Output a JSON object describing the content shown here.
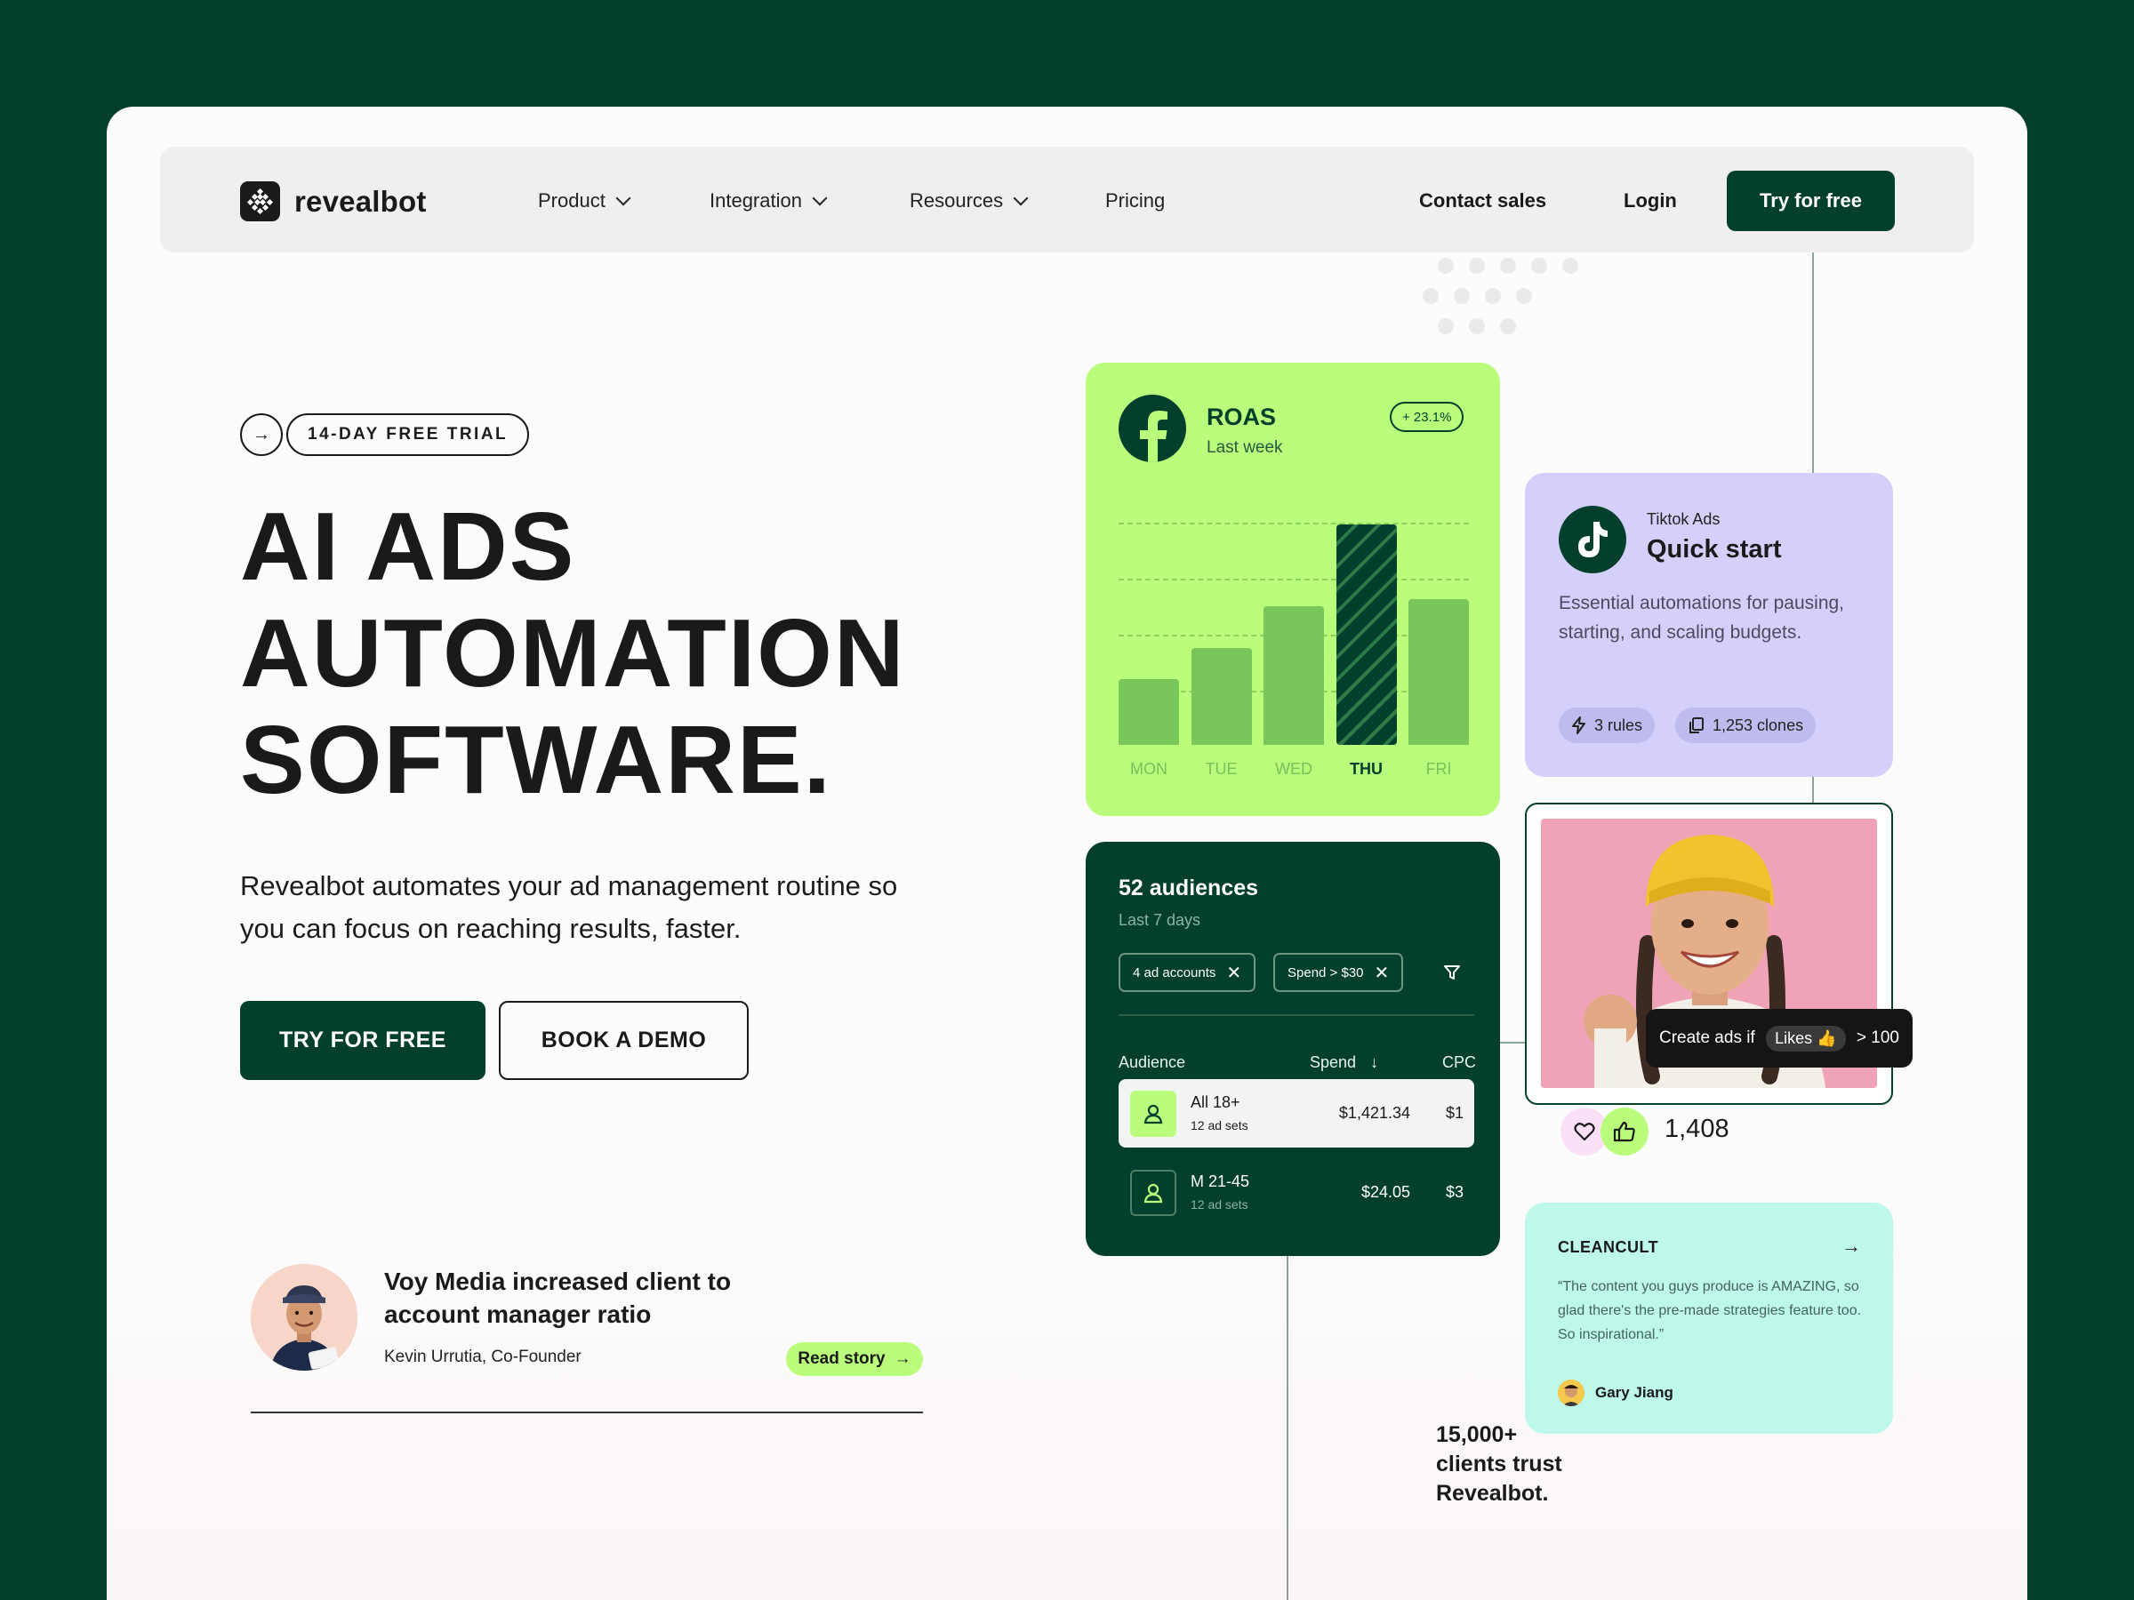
{
  "nav": {
    "brand": "revealbot",
    "items": [
      {
        "label": "Product",
        "has_dropdown": true
      },
      {
        "label": "Integration",
        "has_dropdown": true
      },
      {
        "label": "Resources",
        "has_dropdown": true
      },
      {
        "label": "Pricing",
        "has_dropdown": false
      }
    ],
    "contact": "Contact sales",
    "login": "Login",
    "cta": "Try for free"
  },
  "hero": {
    "badge": "14-DAY FREE TRIAL",
    "headline_lines": [
      "AI ADS",
      "AUTOMATION",
      "SOFTWARE."
    ],
    "subtitle": "Revealbot automates your ad management routine so you can focus on reaching results, faster.",
    "primary_cta": "TRY FOR FREE",
    "secondary_cta": "BOOK A DEMO"
  },
  "story": {
    "title": "Voy Media increased client to account manager ratio",
    "author": "Kevin Urrutia, Co-Founder",
    "link": "Read story"
  },
  "roas_card": {
    "title": "ROAS",
    "subtitle": "Last week",
    "change": "+ 23.1%",
    "icon": "facebook-icon",
    "chart_data": {
      "type": "bar",
      "categories": [
        "MON",
        "TUE",
        "WED",
        "THU",
        "FRI"
      ],
      "values": [
        30,
        44,
        63,
        100,
        66
      ],
      "highlight": "THU",
      "ylim": [
        0,
        100
      ],
      "grid": true
    }
  },
  "tiktok_card": {
    "label": "Tiktok Ads",
    "title": "Quick start",
    "description": "Essential automations for pausing, starting, and scaling budgets.",
    "rules": "3 rules",
    "clones": "1,253 clones",
    "icon": "tiktok-icon"
  },
  "audiences_card": {
    "title": "52 audiences",
    "subtitle": "Last 7 days",
    "filters": [
      "4 ad accounts",
      "Spend > $30"
    ],
    "columns": {
      "audience": "Audience",
      "spend": "Spend",
      "cpc": "CPC"
    },
    "rows": [
      {
        "name": "All 18+",
        "sets": "12 ad sets",
        "spend": "$1,421.34",
        "cpc": "$1",
        "selected": true
      },
      {
        "name": "M 21-45",
        "sets": "12 ad sets",
        "spend": "$24.05",
        "cpc": "$3",
        "selected": false
      }
    ]
  },
  "photo_card": {
    "tooltip_prefix": "Create ads if",
    "tooltip_chip": "Likes 👍",
    "tooltip_suffix": "> 100",
    "likes": "1,408"
  },
  "clients": {
    "lines": [
      "15,000+",
      "clients trust",
      "Revealbot."
    ]
  },
  "quote_card": {
    "brand": "CLEANCULT",
    "text": "“The content you guys produce is AMAZING, so glad there's the pre-made strategies feature too. So inspirational.”",
    "author": "Gary Jiang"
  },
  "colors": {
    "brand_dark": "#033f2d",
    "lime": "#bafd7d",
    "lavender": "#d4d0fb",
    "mint": "#bdf8eb"
  }
}
